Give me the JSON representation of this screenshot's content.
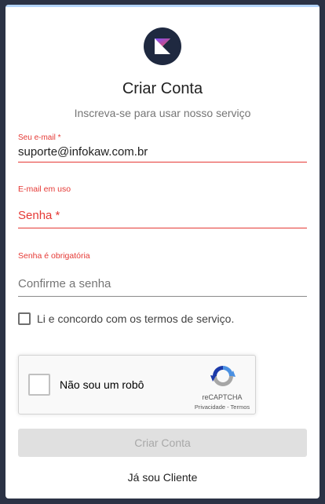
{
  "header": {
    "logo_icon": "kotlin-logo-icon",
    "title": "Criar Conta",
    "subtitle": "Inscreva-se para usar nosso serviço"
  },
  "email": {
    "label": "Seu e-mail *",
    "value": "suporte@infokaw.com.br",
    "error": "E-mail em uso"
  },
  "password": {
    "placeholder": "Senha *",
    "error": "Senha é obrigatória"
  },
  "confirm_password": {
    "placeholder": "Confirme a senha"
  },
  "terms": {
    "label": "Li e concordo com os termos de serviço.",
    "checked": false
  },
  "recaptcha": {
    "label": "Não sou um robô",
    "brand": "reCAPTCHA",
    "links": "Privacidade - Termos",
    "icon": "recaptcha-icon"
  },
  "actions": {
    "submit_label": "Criar Conta",
    "submit_disabled": true,
    "login_link": "Já sou Cliente"
  },
  "colors": {
    "error": "#e53935",
    "logo_bg": "#1f2940",
    "page_bg": "#2b3245"
  }
}
